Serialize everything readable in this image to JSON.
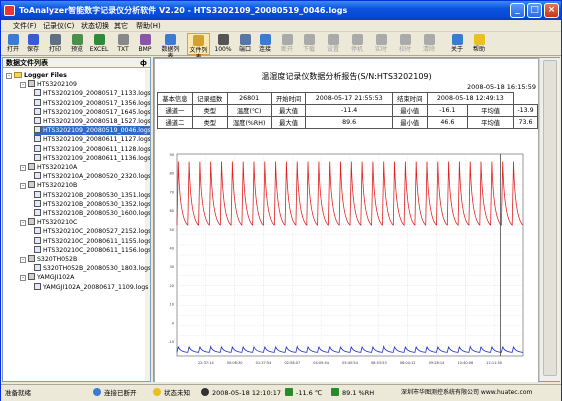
{
  "window": {
    "title": "ToAnalyzer智能数字记录仪分析软件 V2.20 - HTS3202109_20080519_0046.logs",
    "buttons": [
      "_",
      "□",
      "×"
    ]
  },
  "menu": [
    "文件(F)",
    "记录仪(C)",
    "状态切换",
    "其它",
    "帮助(H)"
  ],
  "toolbar": [
    {
      "label": "打开",
      "icon": "open-icon",
      "color": "#3a7bd5"
    },
    {
      "label": "保存",
      "icon": "save-icon",
      "color": "#3a5bd5"
    },
    {
      "label": "打印",
      "icon": "print-icon",
      "color": "#607080"
    },
    {
      "label": "预览",
      "icon": "preview-icon",
      "color": "#4a8f4a"
    },
    {
      "label": "EXCEL",
      "icon": "excel-icon",
      "color": "#2e8b3a"
    },
    {
      "label": "TXT",
      "icon": "txt-icon",
      "color": "#888888"
    },
    {
      "label": "BMP",
      "icon": "bmp-icon",
      "color": "#8855aa"
    },
    {
      "label": "数据列表",
      "icon": "datalist-icon",
      "color": "#3a7bd5"
    },
    {
      "label": "文件列表",
      "icon": "filelist-icon",
      "color": "#d4a030"
    },
    {
      "label": "100%",
      "icon": "zoom-icon",
      "color": "#555555"
    },
    {
      "label": "端口",
      "icon": "port-icon",
      "color": "#5577aa"
    },
    {
      "label": "连接",
      "icon": "connect-icon",
      "color": "#3a7bd5"
    },
    {
      "label": "断开",
      "icon": "disconnect-icon",
      "color": "#aaaaaa"
    },
    {
      "label": "下载",
      "icon": "download-icon",
      "color": "#aaaaaa"
    },
    {
      "label": "设置",
      "icon": "settings-icon",
      "color": "#aaaaaa"
    },
    {
      "label": "停机",
      "icon": "stop-icon",
      "color": "#aaaaaa"
    },
    {
      "label": "实时",
      "icon": "realtime-icon",
      "color": "#aaaaaa"
    },
    {
      "label": "校时",
      "icon": "clock-icon",
      "color": "#aaaaaa"
    },
    {
      "label": "清除",
      "icon": "clear-icon",
      "color": "#aaaaaa"
    },
    {
      "label": "关于",
      "icon": "about-icon",
      "color": "#3a7bd5"
    },
    {
      "label": "帮助",
      "icon": "help-icon",
      "color": "#e8c020"
    }
  ],
  "left_panel": {
    "title": "数据文件列表",
    "pin": "ф",
    "tree": [
      {
        "level": 0,
        "type": "folder",
        "label": "Logger Files"
      },
      {
        "level": 1,
        "type": "device",
        "label": "HTS3202109"
      },
      {
        "level": 2,
        "type": "file",
        "label": "HTS3202109_20080517_1133.logs"
      },
      {
        "level": 2,
        "type": "file",
        "label": "HTS3202109_20080517_1356.logs"
      },
      {
        "level": 2,
        "type": "file",
        "label": "HTS3202109_20080517_1645.logs"
      },
      {
        "level": 2,
        "type": "file",
        "label": "HTS3202109_20080518_1527.logs"
      },
      {
        "level": 2,
        "type": "file",
        "label": "HTS3202109_20080519_0046.logs",
        "selected": true
      },
      {
        "level": 2,
        "type": "file",
        "label": "HTS3202109_20080611_1127.logs"
      },
      {
        "level": 2,
        "type": "file",
        "label": "HTS3202109_20080611_1128.logs"
      },
      {
        "level": 2,
        "type": "file",
        "label": "HTS3202109_20080611_1136.logs"
      },
      {
        "level": 1,
        "type": "device",
        "label": "HTS320210A"
      },
      {
        "level": 2,
        "type": "file",
        "label": "HTS320210A_20080520_2320.logs"
      },
      {
        "level": 1,
        "type": "device",
        "label": "HTS320210B"
      },
      {
        "level": 2,
        "type": "file",
        "label": "HTS320210B_20080530_1351.logs"
      },
      {
        "level": 2,
        "type": "file",
        "label": "HTS320210B_20080530_1352.logs"
      },
      {
        "level": 2,
        "type": "file",
        "label": "HTS320210B_20080530_1600.logs"
      },
      {
        "level": 1,
        "type": "device",
        "label": "HTS320210C"
      },
      {
        "level": 2,
        "type": "file",
        "label": "HTS320210C_20080527_2152.logs"
      },
      {
        "level": 2,
        "type": "file",
        "label": "HTS320210C_20080611_1155.logs"
      },
      {
        "level": 2,
        "type": "file",
        "label": "HTS320210C_20080611_1156.logs"
      },
      {
        "level": 1,
        "type": "device",
        "label": "S320TH052B"
      },
      {
        "level": 2,
        "type": "file",
        "label": "S320TH052B_20080530_1803.logs"
      },
      {
        "level": 1,
        "type": "device",
        "label": "YAMGJI102A"
      },
      {
        "level": 2,
        "type": "file",
        "label": "YAMGJI102A_20080617_1109.logs"
      }
    ]
  },
  "report": {
    "title": "温湿度记录仪数据分析报告(S/N:HTS3202109)",
    "datetime": "2008-05-18 16:15:59",
    "rows": [
      [
        "基本信息",
        "记录组数",
        "26801",
        "开始时间",
        "2008-05-17 21:55:53",
        "结束时间",
        "2008-05-18 12:49:13"
      ],
      [
        "通道一",
        "类型",
        "温度(℃)",
        "最大值",
        "-11.4",
        "最小值",
        "-16.1",
        "平均值",
        "-13.9"
      ],
      [
        "通道二",
        "类型",
        "湿度(%RH)",
        "最大值",
        "89.6",
        "最小值",
        "46.6",
        "平均值",
        "73.6"
      ]
    ]
  },
  "chart_data": {
    "type": "line",
    "title": "",
    "xlabel": "",
    "ylabel": "",
    "x_ticks": [
      "22:37:14",
      "00:08:30",
      "01:37:54",
      "02:58:07",
      "04:09:54",
      "05:40:54",
      "06:53:53",
      "08:04:12",
      "09:28:14",
      "10:40:06",
      "12:11:50"
    ],
    "series": [
      {
        "color": "#e02020",
        "cycles": 32,
        "high": 86,
        "low": 52
      },
      {
        "color": "#2030d0",
        "cycles": 32,
        "high": -13,
        "low": -16
      }
    ],
    "ylim": [
      -18,
      90
    ],
    "grid": true,
    "cursor_x_fraction": 0.935
  },
  "status": {
    "ready": "准备就绪",
    "conn": "连接已断开",
    "state": "状态未知",
    "time": "2008-05-18 12:10:17",
    "temp": "-11.6 ℃",
    "hum": "89.1 %RH",
    "company": "深圳市华图测控系统有限公司 www.huatec.com"
  }
}
